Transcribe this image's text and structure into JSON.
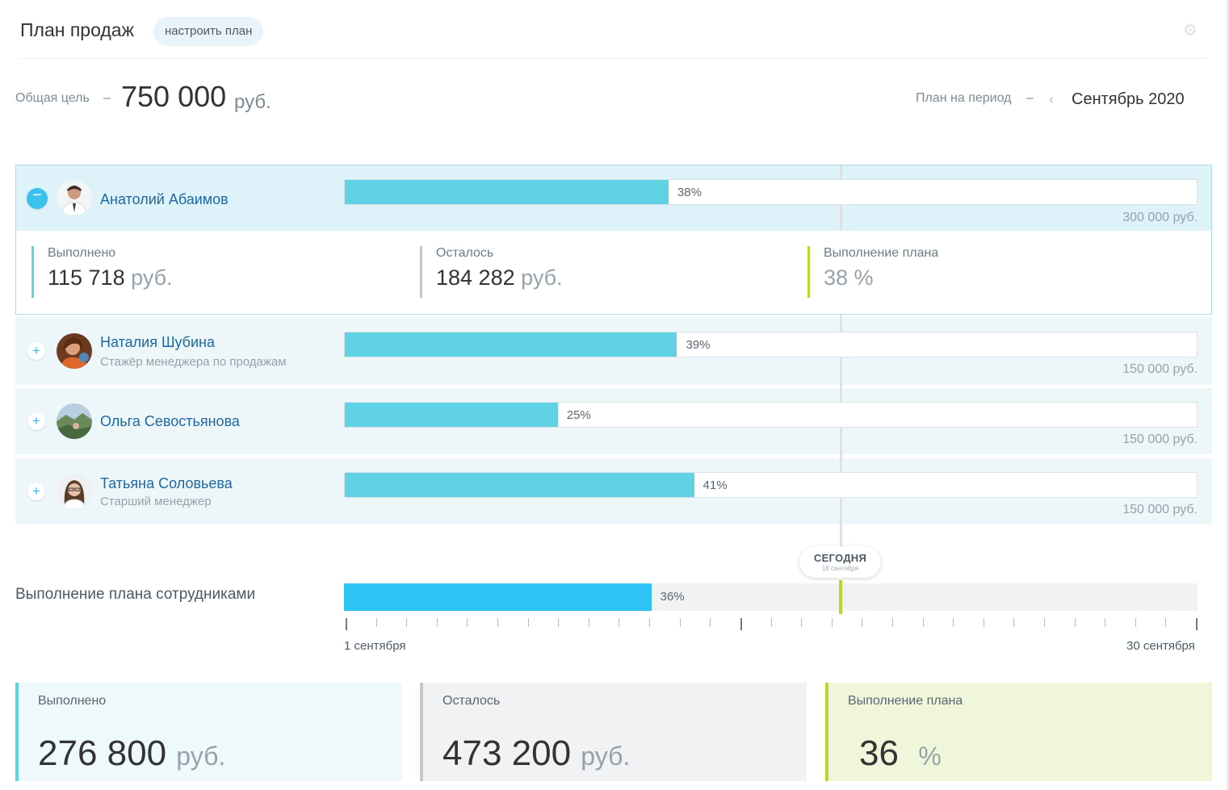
{
  "header": {
    "title": "План продаж",
    "configure_button": "настроить план",
    "settings_icon": "gear-icon"
  },
  "goal": {
    "label": "Общая цель",
    "dash": "–",
    "amount": "750 000",
    "unit": "руб."
  },
  "period": {
    "label": "План на период",
    "dash": "–",
    "prev_icon": "chevron-left-icon",
    "value": "Сентябрь 2020"
  },
  "employees": [
    {
      "name": "Анатолий Абаимов",
      "role": "",
      "progress_pct": 38,
      "progress_label": "38%",
      "target": "300 000 руб.",
      "expanded": true,
      "toggle": "−",
      "stats": {
        "done_label": "Выполнено",
        "done_value": "115 718",
        "done_unit": "руб.",
        "left_label": "Осталось",
        "left_value": "184 282",
        "left_unit": "руб.",
        "plan_label": "Выполнение плана",
        "plan_value": "38 %"
      }
    },
    {
      "name": "Наталия Шубина",
      "role": "Стажёр менеджера по продажам",
      "progress_pct": 39,
      "progress_label": "39%",
      "target": "150 000 руб.",
      "toggle": "+"
    },
    {
      "name": "Ольга Севостьянова",
      "role": "",
      "progress_pct": 25,
      "progress_label": "25%",
      "target": "150 000 руб.",
      "toggle": "+"
    },
    {
      "name": "Татьяна Соловьева",
      "role": "Старший менеджер",
      "progress_pct": 41,
      "progress_label": "41%",
      "target": "150 000 руб.",
      "toggle": "+"
    }
  ],
  "summary": {
    "label": "Выполнение плана сотрудниками",
    "progress_pct": 36,
    "progress_label": "36%",
    "today_title": "СЕГОДНЯ",
    "today_date": "18 сентября",
    "axis_start": "1 сентября",
    "axis_end": "30 сентября"
  },
  "totals": {
    "done_label": "Выполнено",
    "done_value": "276 800",
    "done_unit": "руб.",
    "left_label": "Осталось",
    "left_value": "473 200",
    "left_unit": "руб.",
    "plan_label": "Выполнение плана",
    "plan_value": "36",
    "plan_unit": "%"
  },
  "colors": {
    "accent": "#2fc2f4",
    "bar": "#5fd3e3",
    "link": "#1d67a3",
    "today": "#b6d82e",
    "done_card_bg": "#eef9fc",
    "left_card_bg": "#f1f2f3",
    "plan_card_bg": "#eff6d9"
  }
}
